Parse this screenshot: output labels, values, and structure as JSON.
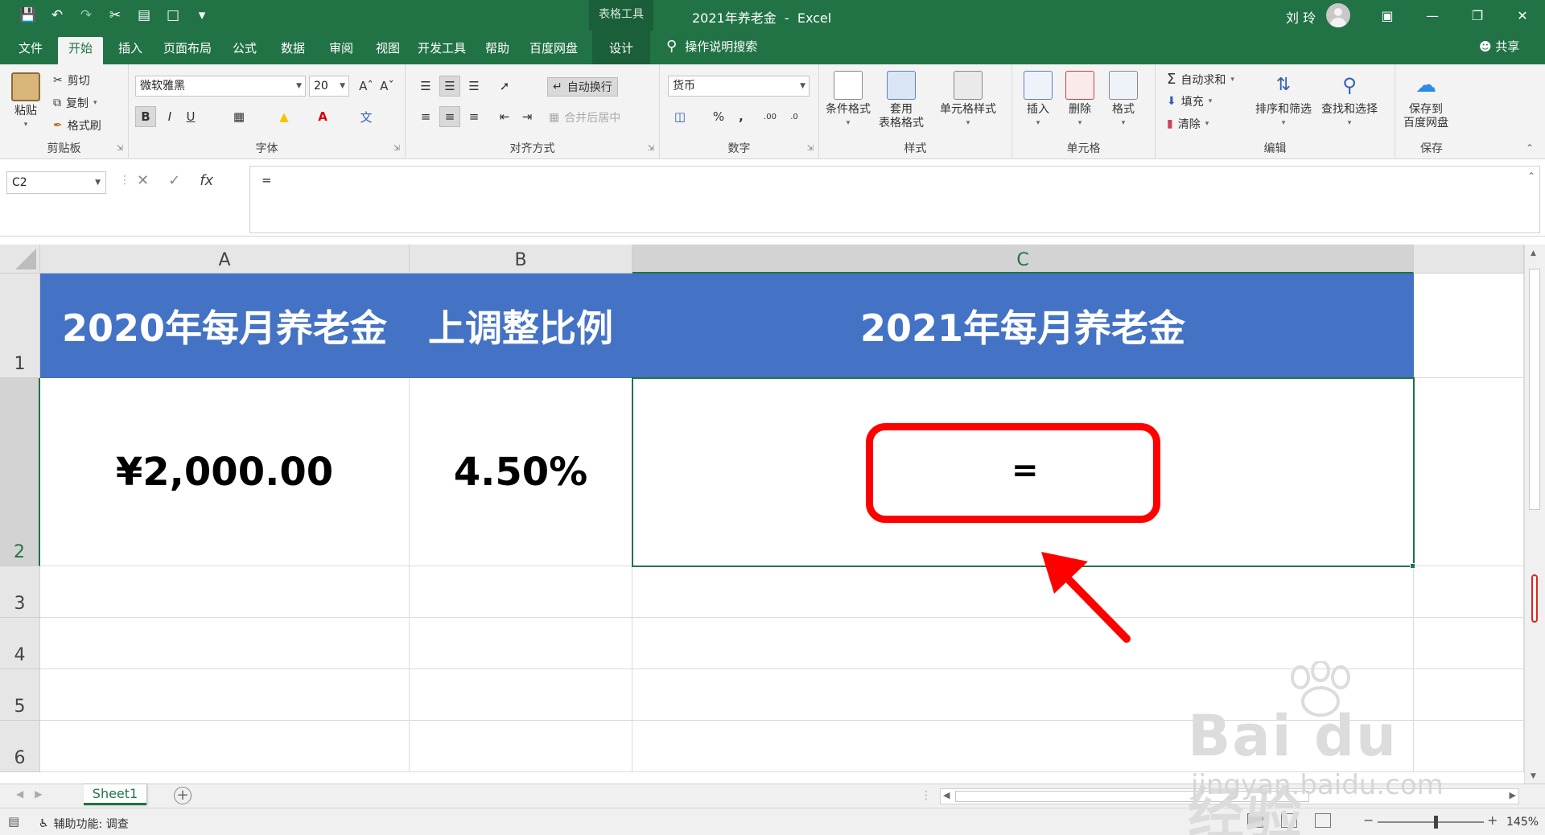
{
  "titlebar": {
    "doc_title": "2021年养老金  -  Excel",
    "context_tool": "表格工具",
    "user": "刘 玲"
  },
  "tabs": [
    "文件",
    "开始",
    "插入",
    "页面布局",
    "公式",
    "数据",
    "审阅",
    "视图",
    "开发工具",
    "帮助",
    "百度网盘",
    "设计"
  ],
  "active_tab": "开始",
  "tell_me": "操作说明搜索",
  "share": "共享",
  "ribbon": {
    "clipboard": {
      "paste": "粘贴",
      "cut": "剪切",
      "copy": "复制",
      "painter": "格式刷",
      "label": "剪贴板"
    },
    "font": {
      "name": "微软雅黑",
      "size": "20",
      "label": "字体"
    },
    "alignment": {
      "wrap": "自动换行",
      "merge": "合并后居中",
      "label": "对齐方式"
    },
    "number": {
      "format": "货币",
      "label": "数字"
    },
    "styles": {
      "cond": "条件格式",
      "table1": "套用",
      "table2": "表格格式",
      "cell": "单元格样式",
      "label": "样式"
    },
    "cells": {
      "insert": "插入",
      "delete": "删除",
      "format": "格式",
      "label": "单元格"
    },
    "editing": {
      "autosum": "自动求和",
      "fill": "填充",
      "clear": "清除",
      "sort": "排序和筛选",
      "find": "查找和选择",
      "label": "编辑"
    },
    "save": {
      "btn1": "保存到",
      "btn2": "百度网盘",
      "label": "保存"
    }
  },
  "formula_bar": {
    "name_box": "C2",
    "formula": "="
  },
  "columns": [
    "A",
    "B",
    "C"
  ],
  "rows": [
    "1",
    "2",
    "3",
    "4",
    "5",
    "6"
  ],
  "cells": {
    "A1": "2020年每月养老金",
    "B1": "上调整比例",
    "C1": "2021年每月养老金",
    "A2": "¥2,000.00",
    "B2": "4.50%",
    "C2": "="
  },
  "sheet_tab": "Sheet1",
  "status": {
    "accessibility": "辅助功能: 调查",
    "zoom": "145%"
  },
  "watermark": {
    "brand": "Bai du 经验",
    "url": "jingyan.baidu.com"
  },
  "colors": {
    "excel_green": "#217346",
    "header_fill": "#4472c4",
    "callout_red": "#ff0000"
  }
}
